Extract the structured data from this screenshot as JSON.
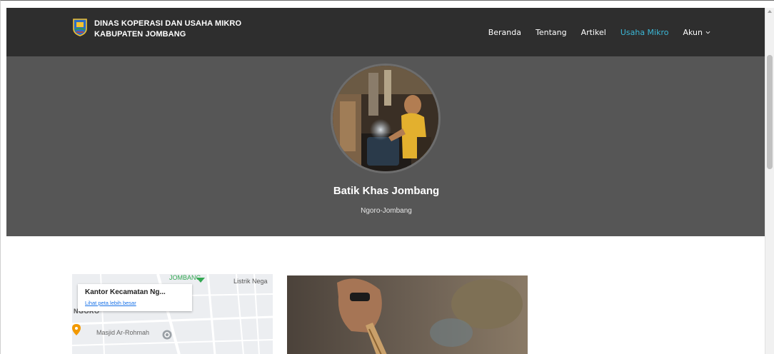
{
  "brand": {
    "line1": "DINAS KOPERASI DAN USAHA MIKRO",
    "line2": "KABUPATEN JOMBANG",
    "logo_icon": "jombang-emblem-icon"
  },
  "nav": {
    "items": [
      {
        "label": "Beranda",
        "active": false
      },
      {
        "label": "Tentang",
        "active": false
      },
      {
        "label": "Artikel",
        "active": false
      },
      {
        "label": "Usaha Mikro",
        "active": true
      }
    ],
    "account_label": "Akun",
    "account_icon": "chevron-down-icon",
    "active_color": "#3bb7d6"
  },
  "profile": {
    "name": "Batik Khas Jombang",
    "location": "Ngoro-Jombang"
  },
  "map": {
    "place_name": "Kantor Kecamatan Ng...",
    "view_larger_link": "Lihat peta lebih besar",
    "labels": {
      "jombang": "JOMBANG",
      "listrik": "Listrik Nega",
      "ngoro": "NGORO",
      "masjid": "Masjid Ar-Rohmah"
    }
  },
  "colors": {
    "navbar_bg": "#2e2e2e",
    "hero_bg": "#565656"
  }
}
